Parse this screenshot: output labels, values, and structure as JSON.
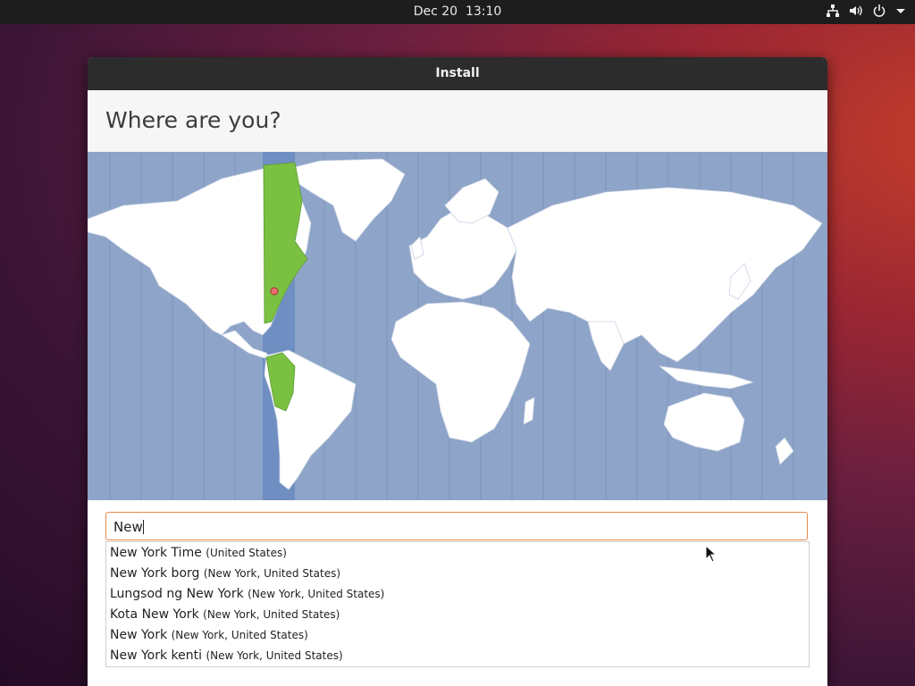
{
  "topbar": {
    "date": "Dec 20",
    "time": "13:10",
    "icons": [
      "network-icon",
      "volume-icon",
      "power-icon",
      "menu-arrow-icon"
    ]
  },
  "window": {
    "title": "Install",
    "heading": "Where are you?"
  },
  "search": {
    "value": "New"
  },
  "suggestions": [
    {
      "name": "New York Time",
      "region": "(United States)"
    },
    {
      "name": "New York borg",
      "region": "(New York, United States)"
    },
    {
      "name": "Lungsod ng New York",
      "region": "(New York, United States)"
    },
    {
      "name": "Kota New York",
      "region": "(New York, United States)"
    },
    {
      "name": "New York",
      "region": "(New York, United States)"
    },
    {
      "name": "New York kenti",
      "region": "(New York, United States)"
    }
  ],
  "colors": {
    "ocean": "#8ea4c8",
    "timezone_band": "#6f8fc2",
    "selected_zone": "#7ac142",
    "land": "#ffffff",
    "accent": "#e9874a"
  }
}
